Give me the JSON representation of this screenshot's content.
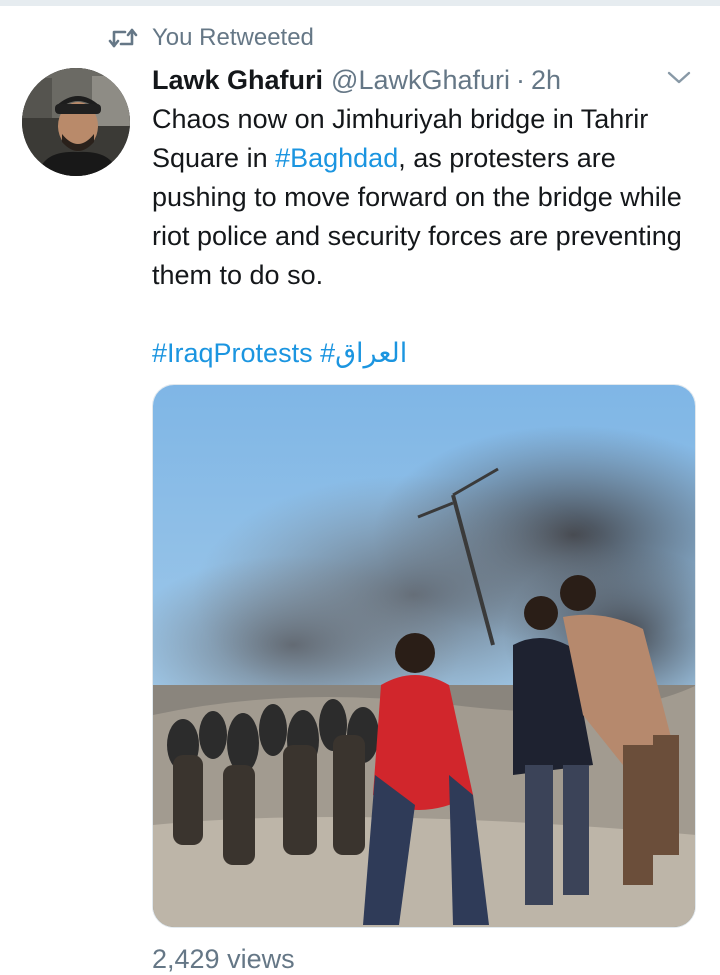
{
  "retweet": {
    "label": "You Retweeted",
    "icon": "retweet-icon"
  },
  "tweet": {
    "author_name": "Lawk Ghafuri",
    "author_handle": "@LawkGhafuri",
    "separator": "·",
    "time": "2h",
    "text_before": "Chaos now on Jimhuriyah bridge in Tahrir Square in ",
    "hashtag_inline": "#Baghdad",
    "text_after": ", as protesters are pushing to move forward on the bridge while riot police and security forces are preventing them to do so.",
    "hashtags_line": "#IraqProtests #العراق",
    "views": "2,429 views"
  },
  "colors": {
    "link": "#1b95e0",
    "secondary": "#657786",
    "text": "#14171a"
  },
  "icons": {
    "caret": "chevron-down-icon"
  }
}
